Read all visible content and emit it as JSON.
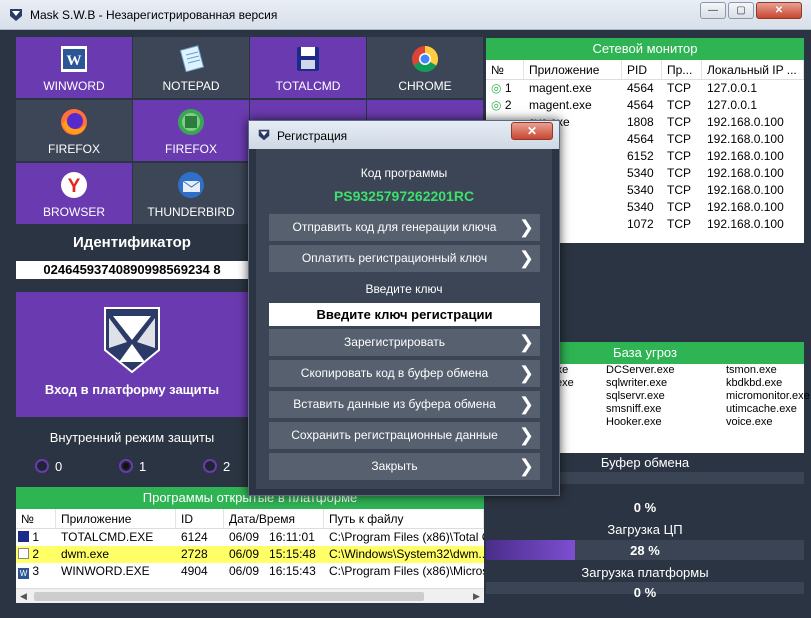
{
  "window": {
    "title": "Mask S.W.B - Незарегистрированная версия"
  },
  "tiles": [
    {
      "label": "WINWORD",
      "icon": "winword-icon"
    },
    {
      "label": "NOTEPAD",
      "icon": "notepad-icon"
    },
    {
      "label": "TOTALCMD",
      "icon": "totalcmd-icon"
    },
    {
      "label": "CHROME",
      "icon": "chrome-icon"
    },
    {
      "label": "FIREFOX",
      "icon": "firefox-icon"
    },
    {
      "label": "FIREFOX",
      "icon": "firefox-green-icon"
    },
    {
      "label": "BROWSER",
      "icon": "yandex-browser-icon"
    },
    {
      "label": "THUNDERBIRD",
      "icon": "thunderbird-icon"
    }
  ],
  "identifier": {
    "label": "Идентификатор",
    "value": "02464593740890998569234 8"
  },
  "platform": {
    "label": "Вход в платформу защиты"
  },
  "mode": {
    "label": "Внутренний режим защиты",
    "options": [
      "0",
      "1",
      "2"
    ],
    "selected": "1"
  },
  "programs": {
    "title": "Программы открытые в платформе",
    "headers": [
      "№",
      "Приложение",
      "ID",
      "Дата/Время",
      "Путь к файлу"
    ],
    "rows": [
      {
        "n": "1",
        "app": "TOTALCMD.EXE",
        "id": "6124",
        "date": "06/09",
        "time": "16:11:01",
        "path": "C:\\Program Files (x86)\\Total C..."
      },
      {
        "n": "2",
        "app": "dwm.exe",
        "id": "2728",
        "date": "06/09",
        "time": "15:15:48",
        "path": "C:\\Windows\\System32\\dwm...."
      },
      {
        "n": "3",
        "app": "WINWORD.EXE",
        "id": "4904",
        "date": "06/09",
        "time": "16:15:43",
        "path": "C:\\Program Files (x86)\\Micros..."
      }
    ]
  },
  "network": {
    "title": "Сетевой монитор",
    "headers": [
      "№",
      "Приложение",
      "PID",
      "Пр...",
      "Локальный IP ..."
    ],
    "rows": [
      {
        "n": "1",
        "app": "magent.exe",
        "pid": "4564",
        "proto": "TCP",
        "ip": "127.0.0.1"
      },
      {
        "n": "2",
        "app": "magent.exe",
        "pid": "4564",
        "proto": "TCP",
        "ip": "127.0.0.1"
      },
      {
        "n": "",
        "app": "svc.exe",
        "pid": "1808",
        "proto": "TCP",
        "ip": "192.168.0.100"
      },
      {
        "n": "",
        "app": "",
        "pid": "4564",
        "proto": "TCP",
        "ip": "192.168.0.100"
      },
      {
        "n": "",
        "app": "e",
        "pid": "6152",
        "proto": "TCP",
        "ip": "192.168.0.100"
      },
      {
        "n": "",
        "app": "xe",
        "pid": "5340",
        "proto": "TCP",
        "ip": "192.168.0.100"
      },
      {
        "n": "",
        "app": "xe",
        "pid": "5340",
        "proto": "TCP",
        "ip": "192.168.0.100"
      },
      {
        "n": "",
        "app": "xe",
        "pid": "5340",
        "proto": "TCP",
        "ip": "192.168.0.100"
      },
      {
        "n": "",
        "app": "xe",
        "pid": "1072",
        "proto": "TCP",
        "ip": "192.168.0.100"
      }
    ]
  },
  "threats": {
    "title": "База угроз",
    "col1": [
      "c.exe",
      "ck.exe"
    ],
    "col2": [
      "DCServer.exe",
      "sqlwriter.exe",
      "sqlservr.exe",
      "smsniff.exe",
      "Hooker.exe"
    ],
    "col3": [
      "tsmon.exe",
      "kbdkbd.exe",
      "micromonitor.exe",
      "utimcache.exe",
      "voice.exe"
    ]
  },
  "clipboard": {
    "label": "Буфер обмена",
    "pct": "0 %",
    "value": 0
  },
  "cpu": {
    "label": "Загрузка ЦП",
    "pct": "28 %",
    "value": 0.28
  },
  "platformLoad": {
    "label": "Загрузка платформы",
    "pct": "0 %",
    "value": 0
  },
  "dialog": {
    "title": "Регистрация",
    "code_label": "Код программы",
    "code": "PS9325797262201RC",
    "btn_send": "Отправить код для генерации ключа",
    "btn_pay": "Оплатить регистрационный ключ",
    "key_label": "Введите ключ",
    "key_placeholder": "Введите ключ регистрации",
    "btn_register": "Зарегистрировать",
    "btn_copy": "Скопировать код в буфер обмена",
    "btn_paste": "Вставить данные из буфера обмена",
    "btn_save": "Сохранить регистрационные данные",
    "btn_close": "Закрыть"
  },
  "colors": {
    "accent": "#6a3bb0",
    "green": "#2fb454",
    "bg": "#2b3442"
  }
}
